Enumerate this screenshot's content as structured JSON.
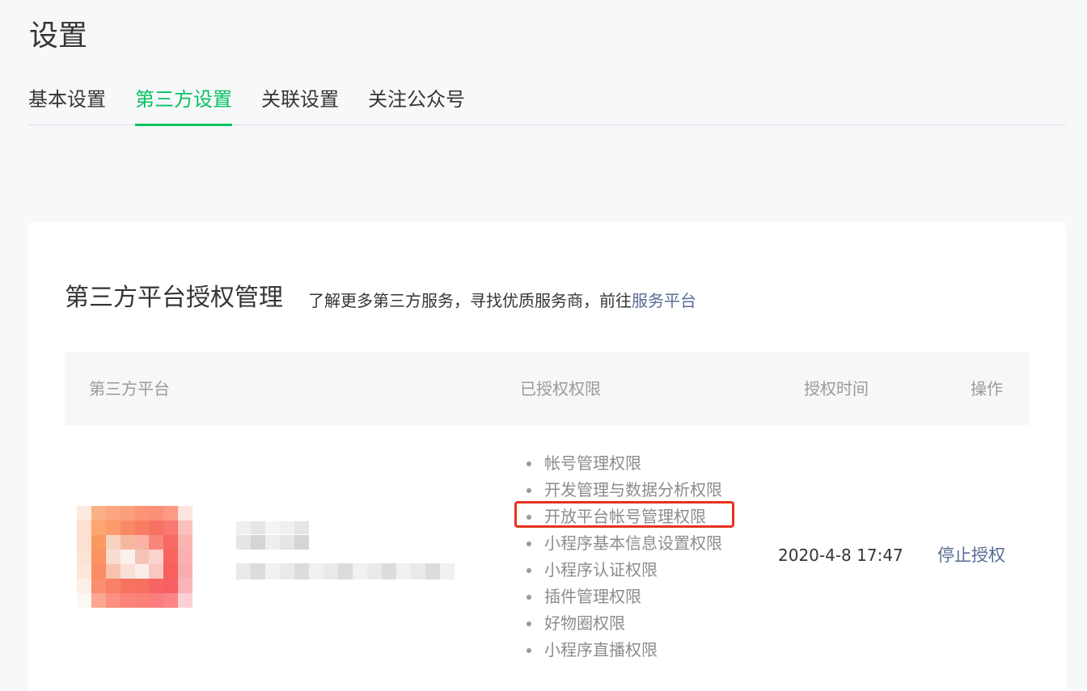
{
  "page": {
    "title": "设置"
  },
  "tabs": [
    {
      "label": "基本设置",
      "active": false
    },
    {
      "label": "第三方设置",
      "active": true
    },
    {
      "label": "关联设置",
      "active": false
    },
    {
      "label": "关注公众号",
      "active": false
    }
  ],
  "colors": {
    "accent": "#07c160",
    "link": "#576b95",
    "highlight": "#e8311f"
  },
  "card": {
    "title": "第三方平台授权管理",
    "desc_prefix": "了解更多第三方服务，寻找优质服务商，前往",
    "desc_link": "服务平台"
  },
  "table": {
    "headers": {
      "platform": "第三方平台",
      "permissions": "已授权权限",
      "time": "授权时间",
      "ops": "操作"
    },
    "rows": [
      {
        "permissions": [
          "帐号管理权限",
          "开发管理与数据分析权限",
          "开放平台帐号管理权限",
          "小程序基本信息设置权限",
          "小程序认证权限",
          "插件管理权限",
          "好物圈权限",
          "小程序直播权限"
        ],
        "auth_time": "2020-4-8 17:47",
        "action": "停止授权"
      }
    ]
  }
}
